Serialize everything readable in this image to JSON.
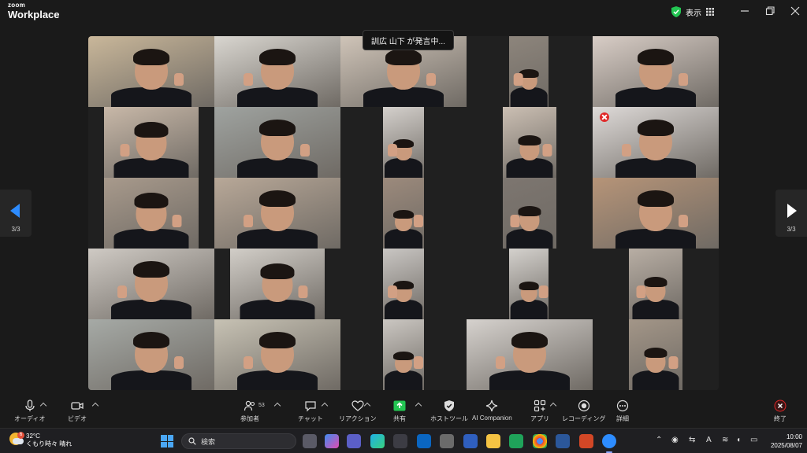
{
  "titlebar": {
    "brand_small": "zoom",
    "brand_big": "Workplace",
    "view_label": "表示"
  },
  "pager": {
    "left_label": "3/3",
    "right_label": "3/3"
  },
  "meeting": {
    "speaking_notice": "訓広 山下 が発言中..."
  },
  "toolbar": {
    "audio_label": "オーディオ",
    "video_label": "ビデオ",
    "participants_label": "参加者",
    "participants_count": "53",
    "chat_label": "チャット",
    "reactions_label": "リアクション",
    "share_label": "共有",
    "host_tools_label": "ホストツール",
    "ai_companion_label": "AI Companion",
    "apps_label": "アプリ",
    "recording_label": "レコーディング",
    "more_label": "詳細",
    "end_label": "終了"
  },
  "taskbar": {
    "temperature": "32°C",
    "weather_text": "くもり時々 晴れ",
    "weather_badge": "6",
    "search_placeholder": "検索",
    "ime_indicator": "A",
    "time": "10:00",
    "date": "2025/08/07"
  },
  "colors": {
    "accent_blue": "#2d8cff",
    "share_green": "#23c552",
    "end_red": "#e02828"
  }
}
